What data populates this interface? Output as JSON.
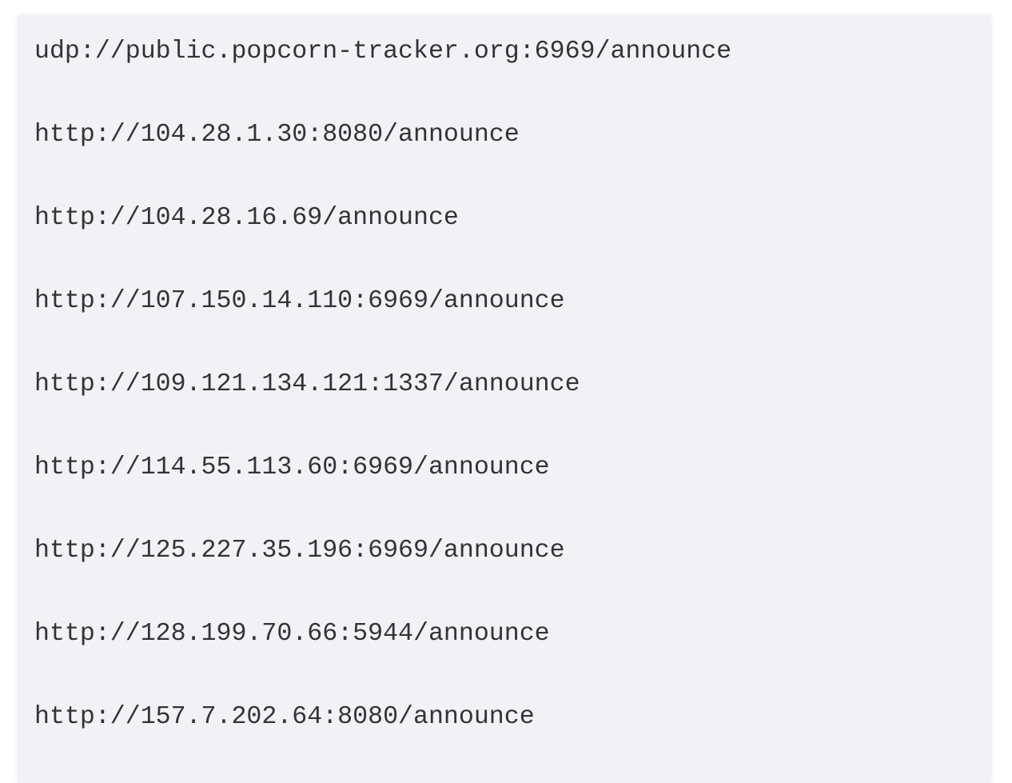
{
  "trackers": [
    "udp://public.popcorn-tracker.org:6969/announce",
    "http://104.28.1.30:8080/announce",
    "http://104.28.16.69/announce",
    "http://107.150.14.110:6969/announce",
    "http://109.121.134.121:1337/announce",
    "http://114.55.113.60:6969/announce",
    "http://125.227.35.196:6969/announce",
    "http://128.199.70.66:5944/announce",
    "http://157.7.202.64:8080/announce"
  ]
}
